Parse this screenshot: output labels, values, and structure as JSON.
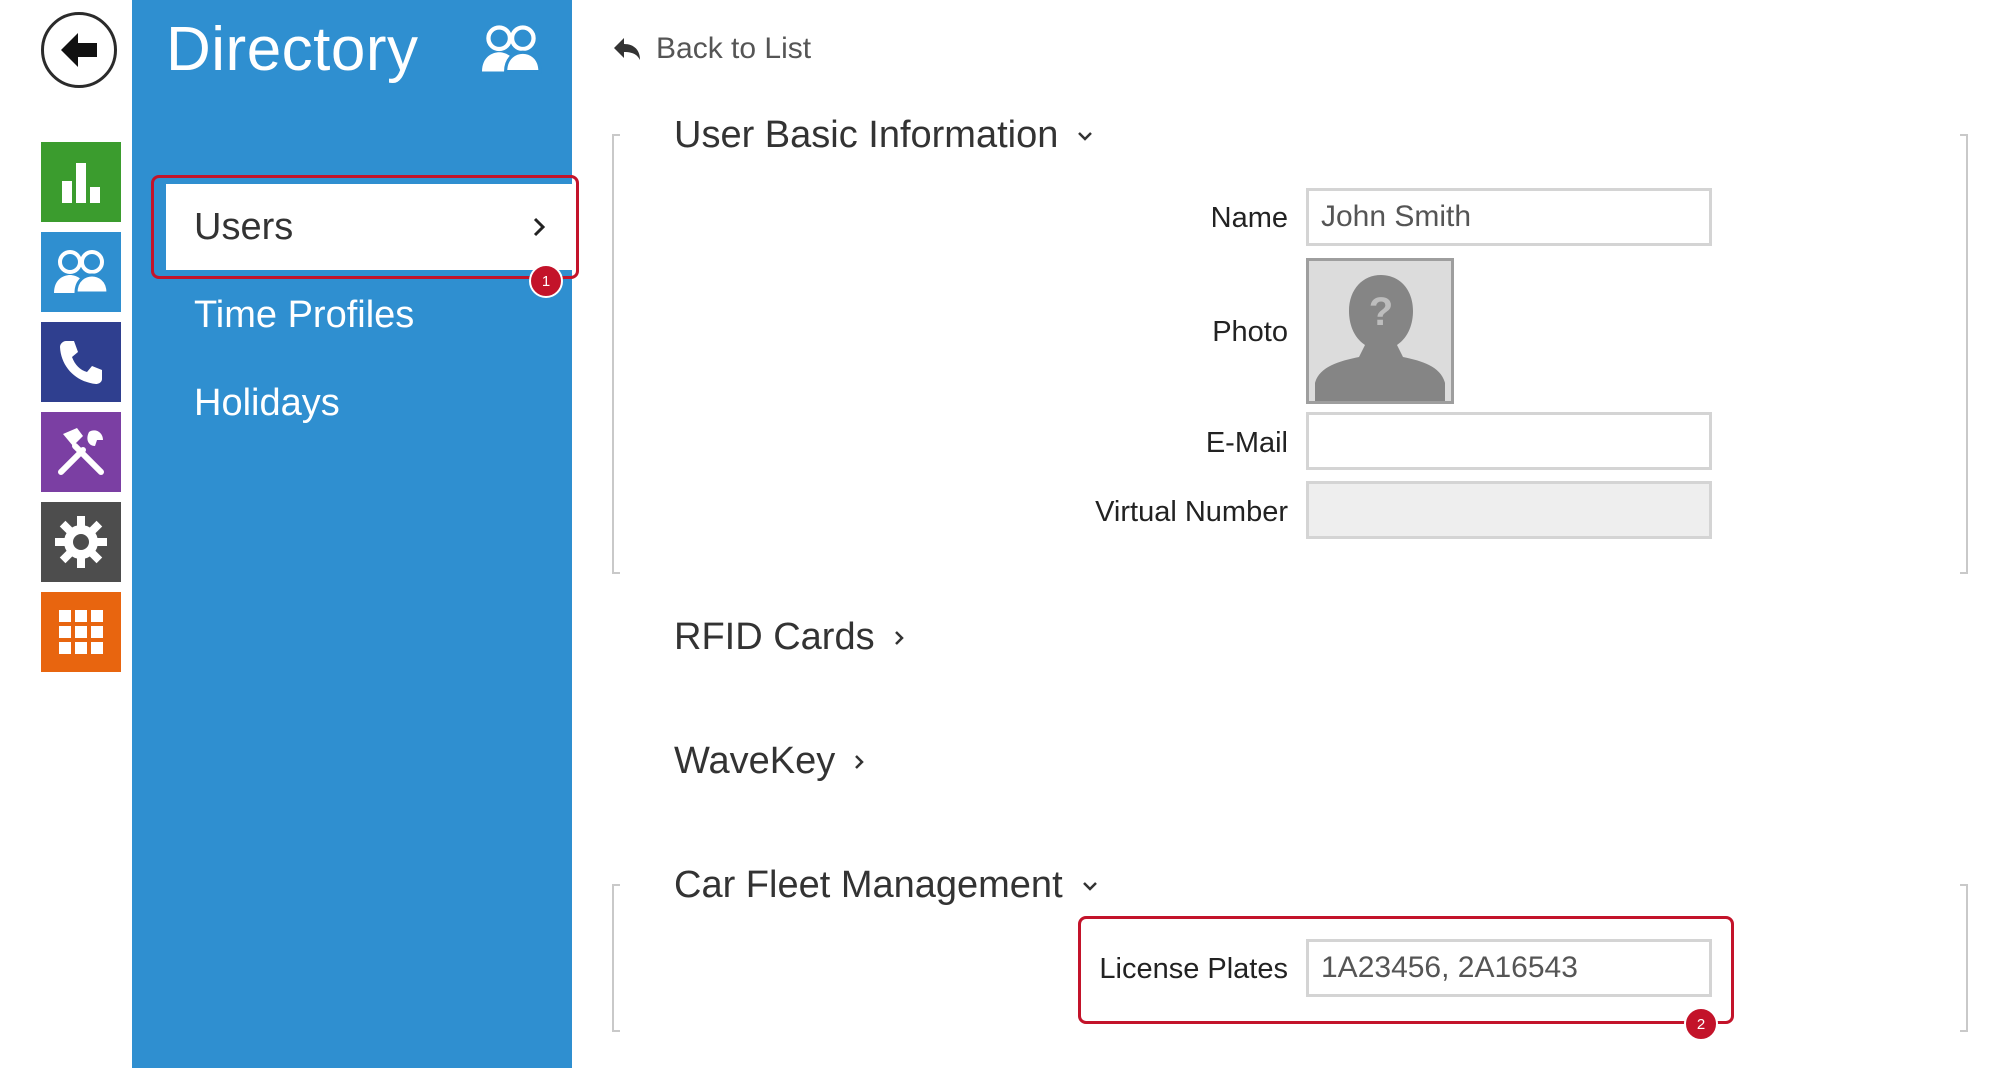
{
  "sidebar": {
    "title": "Directory",
    "items": [
      {
        "label": "Users",
        "active": true
      },
      {
        "label": "Time Profiles"
      },
      {
        "label": "Holidays"
      }
    ],
    "rail_icons": [
      "back-arrow-icon",
      "chart-icon",
      "users-icon",
      "phone-icon",
      "tools-icon",
      "gear-icon",
      "grid-icon"
    ],
    "rail_colors": [
      "#3b9c2e",
      "#2f8fd0",
      "#2f3f8f",
      "#7b3fa3",
      "#4d4d4d",
      "#e8650f"
    ]
  },
  "main": {
    "back_label": "Back to List",
    "sections": {
      "basic": {
        "title": "User Basic Information",
        "fields": {
          "name_label": "Name",
          "name_value": "John Smith",
          "photo_label": "Photo",
          "email_label": "E-Mail",
          "email_value": "",
          "virtual_number_label": "Virtual Number",
          "virtual_number_value": ""
        }
      },
      "rfid": {
        "title": "RFID Cards"
      },
      "wavekey": {
        "title": "WaveKey"
      },
      "car_fleet": {
        "title": "Car Fleet Management",
        "license_plates_label": "License Plates",
        "license_plates_value": "1A23456, 2A16543"
      }
    }
  },
  "annotations": {
    "badge1": "1",
    "badge2": "2",
    "highlight_color": "#c3132a"
  },
  "colors": {
    "panel": "#2f8fd0",
    "accent_red": "#c3132a"
  }
}
